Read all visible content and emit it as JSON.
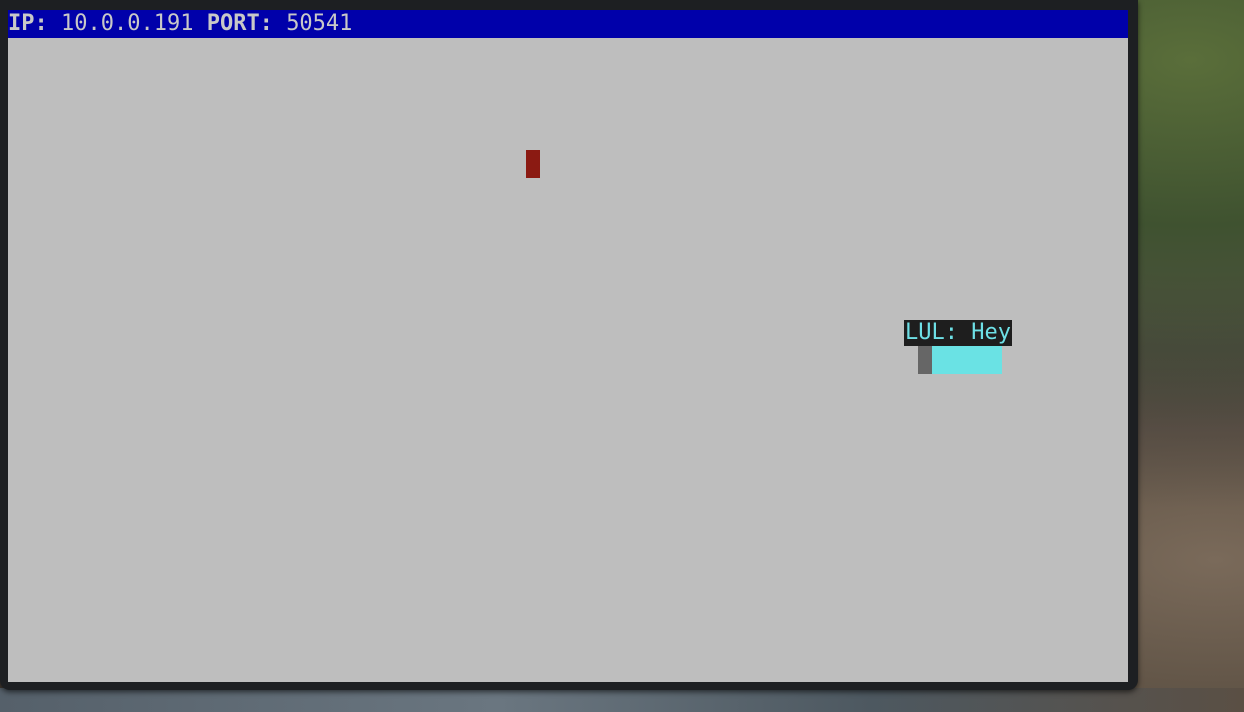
{
  "status_bar": {
    "ip_label": "IP:",
    "ip_value": "10.0.0.191",
    "port_label": "PORT:",
    "port_value": "50541"
  },
  "chat": {
    "message": "LUL: Hey"
  },
  "colors": {
    "status_bar_bg": "#0000aa",
    "screen_bg": "#bebebe",
    "player_marker": "#8b1a12",
    "other_player": "#6ae2e4",
    "chat_text": "#6ee0e6"
  }
}
